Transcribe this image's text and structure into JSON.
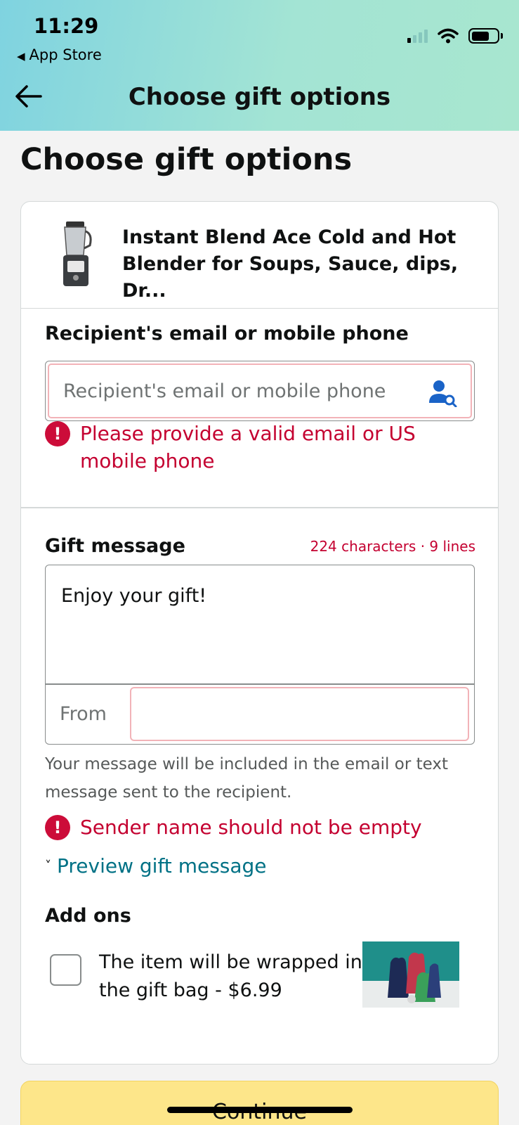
{
  "status_bar": {
    "time": "11:29",
    "back_app": "App Store"
  },
  "nav": {
    "title": "Choose gift options"
  },
  "page": {
    "title": "Choose gift options"
  },
  "product": {
    "title": "Instant Blend Ace Cold and Hot Blender for Soups, Sauce, dips, Dr..."
  },
  "recipient": {
    "label": "Recipient's email or mobile phone",
    "placeholder": "Recipient's email or mobile phone",
    "error": "Please provide a valid email or US mobile phone"
  },
  "gift_message": {
    "label": "Gift message",
    "counter": "224 characters · 9 lines",
    "value": "Enjoy your gift!",
    "from_label": "From",
    "from_value": "",
    "note": "Your message will be included in the email or text message sent to the recipient.",
    "error": "Sender name should not be empty",
    "preview_link": "Preview gift message"
  },
  "addons": {
    "label": "Add ons",
    "wrap_text": "The item will be wrapped in the gift bag - $6.99",
    "wrap_checked": false
  },
  "footer": {
    "continue_label": "Continue"
  },
  "colors": {
    "error": "#c40030",
    "link": "#007185",
    "continue_bg": "#fde68a"
  }
}
